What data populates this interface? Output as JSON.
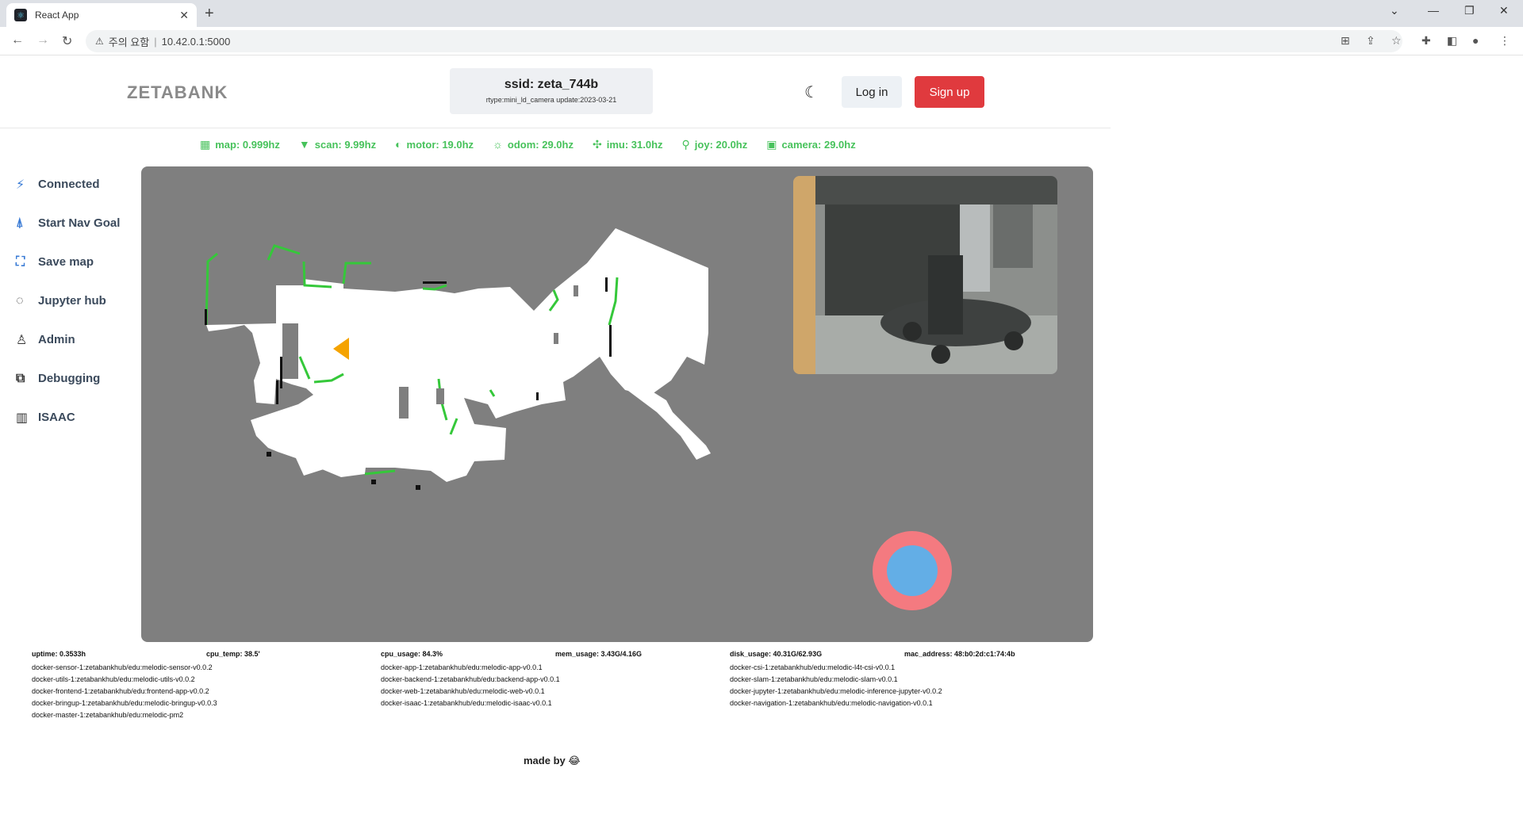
{
  "browser": {
    "tab_title": "React App",
    "tab_close": "✕",
    "new_tab": "+",
    "security_label": "주의 요함",
    "url": "10.42.0.1:5000"
  },
  "header": {
    "logo": "ZETABANK",
    "ssid": "ssid: zeta_744b",
    "meta": "rtype:mini_ld_camera update:2023-03-21",
    "login": "Log in",
    "signup": "Sign up",
    "colors": {
      "signup": "#e03a3e",
      "login_bg": "#edf1f5"
    }
  },
  "rates": [
    {
      "icon": "grid-icon",
      "label": "map: 0.999hz"
    },
    {
      "icon": "wifi-icon",
      "label": "scan: 9.99hz"
    },
    {
      "icon": "motor-icon",
      "label": "motor: 19.0hz"
    },
    {
      "icon": "sun-icon",
      "label": "odom: 29.0hz"
    },
    {
      "icon": "imu-icon",
      "label": "imu: 31.0hz"
    },
    {
      "icon": "joystick-icon",
      "label": "joy: 20.0hz"
    },
    {
      "icon": "camera-icon",
      "label": "camera: 29.0hz"
    }
  ],
  "rate_color": "#47c25b",
  "sidebar": {
    "items": [
      {
        "icon": "connected-icon",
        "label": "Connected"
      },
      {
        "icon": "nav-goal-icon",
        "label": "Start Nav Goal"
      },
      {
        "icon": "map-icon",
        "label": "Save map"
      },
      {
        "icon": "jupyter-icon",
        "label": "Jupyter hub"
      },
      {
        "icon": "admin-icon",
        "label": "Admin"
      },
      {
        "icon": "debug-icon",
        "label": "Debugging"
      },
      {
        "icon": "chart-icon",
        "label": "ISAAC"
      }
    ]
  },
  "map": {
    "background": "#7f7f7f",
    "free_space": "#ffffff",
    "scan_color": "#35c83a",
    "joystick_outer": "#f47a80",
    "joystick_knob": "#63aee6"
  },
  "stats": {
    "uptime": "uptime: 0.3533h",
    "cpu_temp": "cpu_temp: 38.5'",
    "cpu_usage": "cpu_usage: 84.3%",
    "mem_usage": "mem_usage: 3.43G/4.16G",
    "disk_usage": "disk_usage: 40.31G/62.93G",
    "mac_address": "mac_address: 48:b0:2d:c1:74:4b"
  },
  "docker": {
    "col1": [
      "docker-sensor-1:zetabankhub/edu:melodic-sensor-v0.0.2",
      "docker-utils-1:zetabankhub/edu:melodic-utils-v0.0.2",
      "docker-frontend-1:zetabankhub/edu:frontend-app-v0.0.2",
      "docker-bringup-1:zetabankhub/edu:melodic-bringup-v0.0.3",
      "docker-master-1:zetabankhub/edu:melodic-pm2"
    ],
    "col2": [
      "docker-app-1:zetabankhub/edu:melodic-app-v0.0.1",
      "docker-backend-1:zetabankhub/edu:backend-app-v0.0.1",
      "docker-web-1:zetabankhub/edu:melodic-web-v0.0.1",
      "docker-isaac-1:zetabankhub/edu:melodic-isaac-v0.0.1"
    ],
    "col3": [
      "docker-csi-1:zetabankhub/edu:melodic-l4t-csi-v0.0.1",
      "docker-slam-1:zetabankhub/edu:melodic-slam-v0.0.1",
      "docker-jupyter-1:zetabankhub/edu:melodic-inference-jupyter-v0.0.2",
      "docker-navigation-1:zetabankhub/edu:melodic-navigation-v0.0.1"
    ]
  },
  "footer": {
    "made_by": "made by 😂"
  }
}
